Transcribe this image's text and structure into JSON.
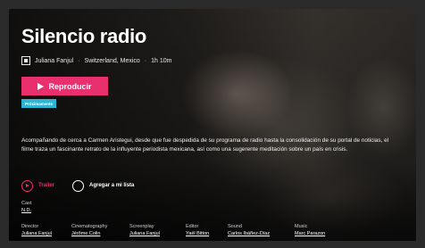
{
  "movie": {
    "title": "Silencio radio",
    "director_name": "Juliana Fanjul",
    "countries": "Switzerland, Mexico",
    "duration": "1h 10m",
    "separator": "·",
    "play_label": "Reproducir",
    "badge": "Próximamente",
    "synopsis": "Acompañando de cerca a Carmen Aristegui, desde que fue despedida de su programa de radio hasta la consolidación de su portal de noticias, el filme traza un fascinante retrato de la influyente periodista mexicana, así como una sugerente meditación sobre un país en crisis.",
    "trailer_label": "Trailer",
    "add_list_label": "Agregar a mi lista",
    "cast": {
      "label": "Cast",
      "value": "N.D."
    },
    "credits": [
      {
        "label": "Director",
        "value": "Juliana Fanjul"
      },
      {
        "label": "Cinematography",
        "value": "Jérôme Colin"
      },
      {
        "label": "Screenplay",
        "value": "Juliana Fanjul"
      },
      {
        "label": "Editor",
        "value": "Yaël Bitton"
      },
      {
        "label": "Sound",
        "value": "Carlos Ibáñez-Díaz"
      },
      {
        "label": "Music",
        "value": "Marc Parazon"
      }
    ],
    "colors": {
      "accent": "#e8306f",
      "badge": "#2eb5d6"
    },
    "icons": {
      "meta": "square-icon",
      "play": "play-icon",
      "trailer": "play-circle-icon",
      "add": "circle-icon"
    }
  }
}
